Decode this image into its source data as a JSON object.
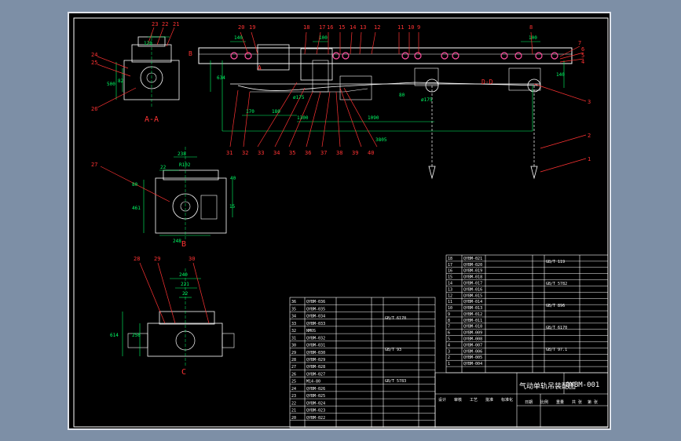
{
  "colors": {
    "background_outer": "#7d8fa6",
    "sheet": "#000000",
    "line": "#ffffff",
    "dimension": "#00ff66",
    "balloon": "#ff3333",
    "bom_line": "#ffffff",
    "highlight": "#ff4fa0"
  },
  "views": {
    "section_aa": {
      "label": "A-A",
      "dims": [
        "500",
        "82"
      ],
      "balloons": [
        "23",
        "22",
        "21",
        "24",
        "25",
        "26"
      ],
      "note": "120"
    },
    "section_b": {
      "label": "B",
      "dims": [
        "238",
        "R102",
        "22",
        "40",
        "80",
        "15",
        "248",
        "461"
      ],
      "balloons": [
        "27"
      ]
    },
    "section_c": {
      "label": "C",
      "dims": [
        "240",
        "221",
        "22",
        "614",
        "256"
      ],
      "balloons": [
        "28",
        "29",
        "30"
      ]
    },
    "main": {
      "label_a": "A",
      "label_b": "B",
      "label_dd": "D-D",
      "dims": [
        "1090",
        "3805",
        "170",
        "180",
        "1300",
        "80",
        "ø175",
        "ø175",
        "634",
        "140",
        "100",
        "100",
        "140"
      ],
      "top_balloons": [
        "20",
        "19",
        "18",
        "17",
        "16",
        "15",
        "14",
        "13",
        "12",
        "11",
        "10",
        "9",
        "8",
        "7",
        "6",
        "5",
        "4"
      ],
      "bottom_balloons": [
        "31",
        "32",
        "33",
        "34",
        "35",
        "36",
        "37",
        "38",
        "39",
        "40"
      ],
      "side_balloons": [
        "3",
        "2",
        "1"
      ]
    }
  },
  "bom": {
    "title": "气动单轨吊装配图",
    "drawing_no": "QYBM-001",
    "left_rows": [
      "QYBM-036",
      "QYBM-035",
      "QYBM-034",
      "QYBM-033",
      "NMOS",
      "QYBM-032",
      "QYBM-031",
      "QYBM-030",
      "QYBM-029",
      "QYBM-028",
      "QYBM-027",
      "M14-80",
      "QYBM-026",
      "QYBM-025",
      "QYBM-024",
      "QYBM-023",
      "QYBM-022"
    ],
    "left_std": [
      "GB/T 6170",
      "GB/T 93",
      "GB/T 5783"
    ],
    "right_rows": [
      "QYBM-021",
      "QYBM-020",
      "QYBM-019",
      "QYBM-018",
      "QYBM-017",
      "QYBM-016",
      "QYBM-015",
      "QYBM-014",
      "QYBM-013",
      "QYBM-012",
      "QYBM-011",
      "QYBM-010",
      "QYBM-009",
      "QYBM-008",
      "QYBM-007",
      "QYBM-006",
      "QYBM-005",
      "QYBM-004"
    ],
    "right_std": [
      "GB/T 119",
      "GB/T 5782",
      "GB/T 896",
      "GB/T 6170",
      "GB/T 97.1"
    ],
    "title_block_fields": [
      "设计",
      "审核",
      "工艺",
      "批准",
      "标准化",
      "日期",
      "比例",
      "重量",
      "共 张",
      "第 张"
    ]
  }
}
